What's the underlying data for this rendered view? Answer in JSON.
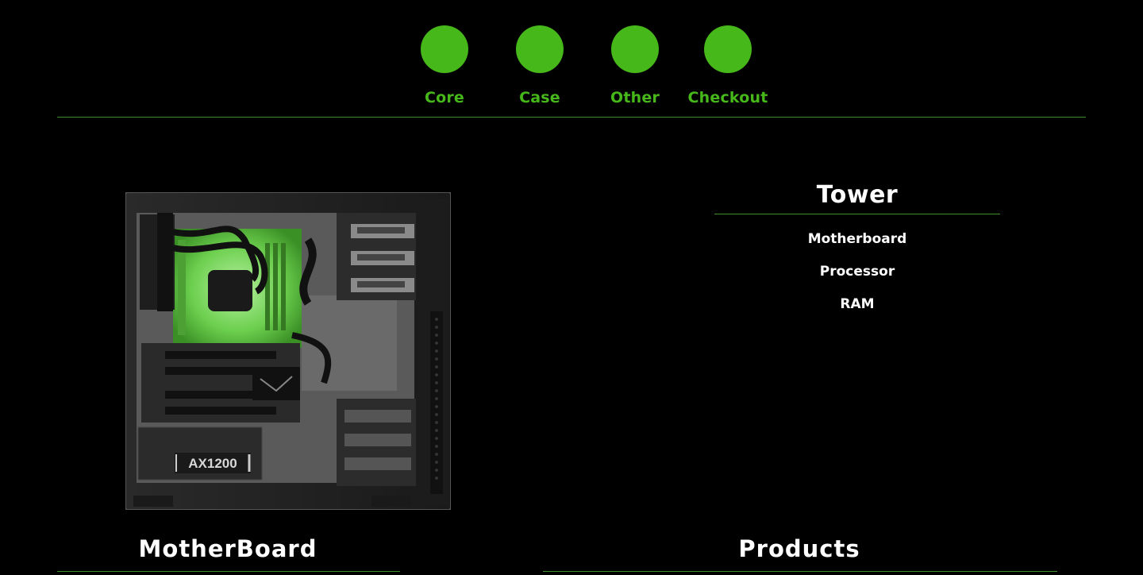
{
  "steps": [
    {
      "label": "Core"
    },
    {
      "label": "Case"
    },
    {
      "label": "Other"
    },
    {
      "label": "Checkout"
    }
  ],
  "colors": {
    "accent": "#46b81a",
    "divider": "#3f8f2a",
    "background": "#000000",
    "text": "#ffffff"
  },
  "case_image": {
    "psu_label": "AX1200",
    "icon": "pc-case-image"
  },
  "tower": {
    "title": "Tower",
    "items": [
      "Motherboard",
      "Processor",
      "RAM"
    ]
  },
  "sections": {
    "motherboard_title": "MotherBoard",
    "products_title": "Products"
  }
}
